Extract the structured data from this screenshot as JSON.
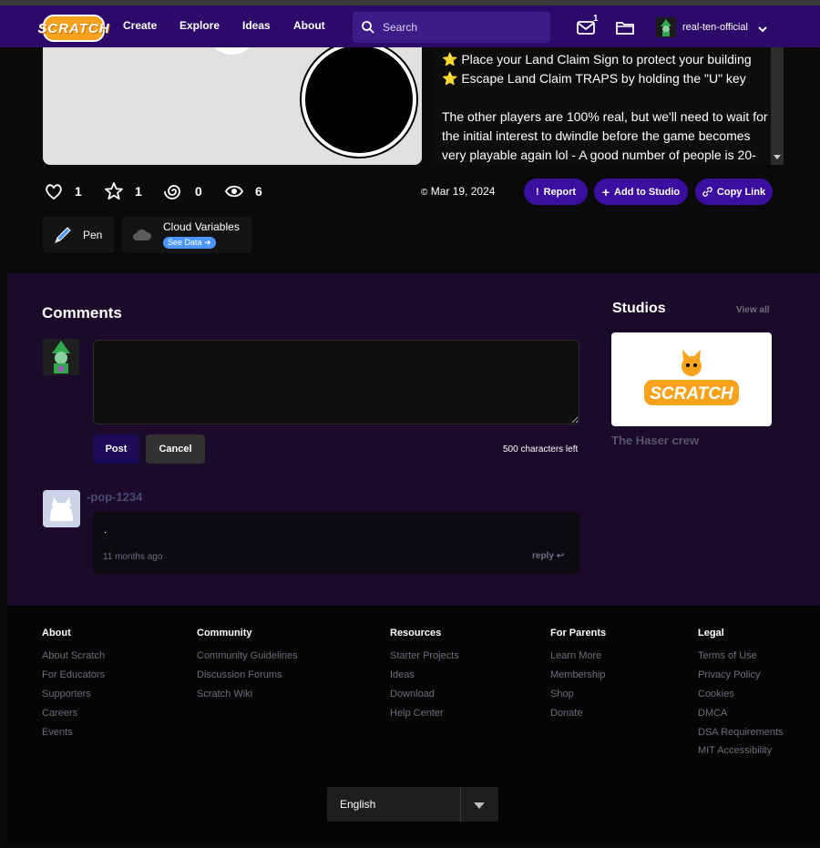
{
  "navbar": {
    "logo_text": "SCRATCH",
    "links": [
      "Create",
      "Explore",
      "Ideas",
      "About"
    ],
    "search_placeholder": "Search",
    "message_count": "1",
    "username": "real-ten-official"
  },
  "project": {
    "description_lines": [
      "⭐ Place your Land Claim Sign to protect your building",
      "⭐ Escape Land Claim TRAPS by holding the \"U\" key",
      "",
      "The other players are 100% real, but we'll need to wait for the initial interest to dwindle before the game becomes very playable again lol - A good number of people is 20-"
    ],
    "stats": {
      "loves": "1",
      "favorites": "1",
      "remixes": "0",
      "views": "6"
    },
    "date": "Mar 19, 2024",
    "date_icon": "©",
    "buttons": {
      "report": "Report",
      "add_to_studio": "Add to Studio",
      "copy_link": "Copy Link"
    },
    "extensions": [
      {
        "label": "Pen"
      },
      {
        "label": "Cloud Variables",
        "badge": "See Data"
      }
    ]
  },
  "comments": {
    "title": "Comments",
    "post_label": "Post",
    "cancel_label": "Cancel",
    "chars_left": "500 characters left",
    "items": [
      {
        "user": "-pop-1234",
        "text": ".",
        "time": "11 months ago",
        "reply": "reply"
      }
    ]
  },
  "studios": {
    "title": "Studios",
    "view_all": "View all",
    "items": [
      {
        "name": "The Haser crew",
        "thumb_text": "SCRATCH"
      }
    ]
  },
  "footer": {
    "columns": [
      {
        "title": "About",
        "links": [
          "About Scratch",
          "For Educators",
          "Supporters",
          "Careers",
          "Events"
        ]
      },
      {
        "title": "Community",
        "links": [
          "Community Guidelines",
          "Discussion Forums",
          "Scratch Wiki"
        ]
      },
      {
        "title": "Resources",
        "links": [
          "Starter Projects",
          "Ideas",
          "Download",
          "Help Center"
        ]
      },
      {
        "title": "For Parents",
        "links": [
          "Learn More",
          "Membership",
          "Shop",
          "Donate"
        ]
      },
      {
        "title": "Legal",
        "links": [
          "Terms of Use",
          "Privacy Policy",
          "Cookies",
          "DMCA",
          "DSA Requirements",
          "MIT Accessibility"
        ]
      }
    ],
    "language": "English"
  },
  "colors": {
    "navbar_bg": "#2b0a6a",
    "action_pill": "#3a0fa0",
    "scratch_orange": "#f7a21b",
    "page_bg": "#0a0a0a"
  }
}
